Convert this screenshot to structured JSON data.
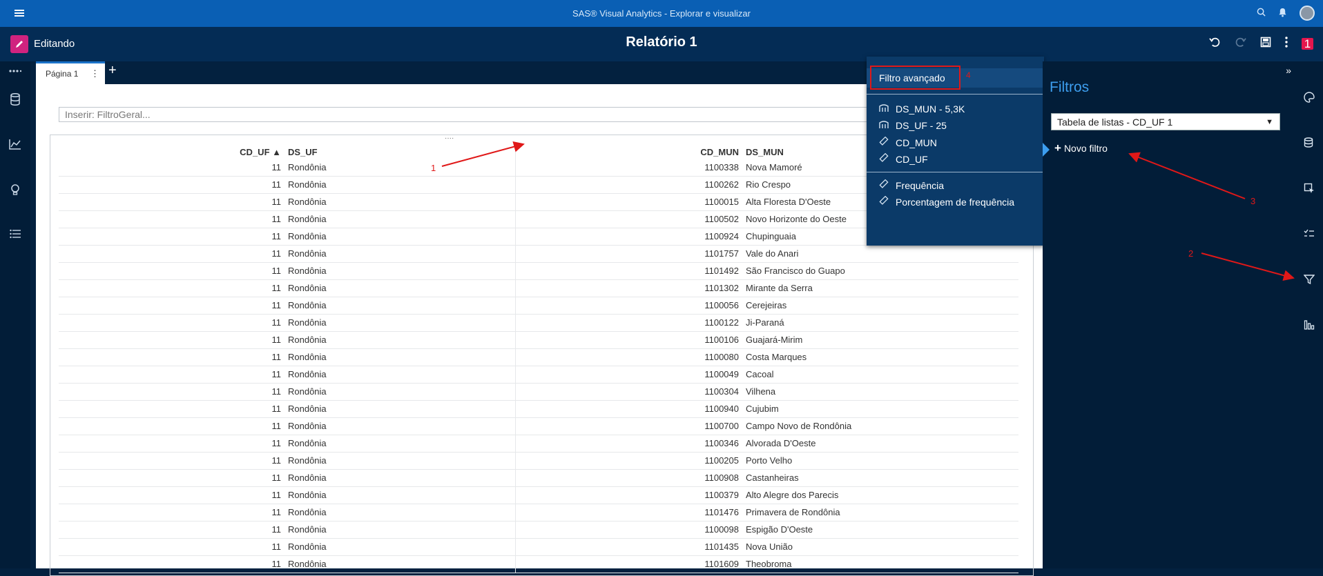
{
  "app": {
    "title": "SAS® Visual Analytics - Explorar e visualizar"
  },
  "topbar_icons": [
    "menu-icon",
    "search-icon",
    "bell-icon",
    "user-avatar"
  ],
  "editbar": {
    "mode_label": "Editando",
    "report_title": "Relatório 1",
    "notification_count": "1"
  },
  "tabs": [
    {
      "label": "Página 1"
    }
  ],
  "filter_input": {
    "placeholder": "Inserir: FiltroGeral..."
  },
  "table": {
    "columns": [
      "CD_UF ▲",
      "DS_UF",
      "CD_MUN",
      "DS_MUN"
    ],
    "rows": [
      [
        "11",
        "Rondônia",
        "1100338",
        "Nova Mamoré"
      ],
      [
        "11",
        "Rondônia",
        "1100262",
        "Rio Crespo"
      ],
      [
        "11",
        "Rondônia",
        "1100015",
        "Alta Floresta D'Oeste"
      ],
      [
        "11",
        "Rondônia",
        "1100502",
        "Novo Horizonte do Oeste"
      ],
      [
        "11",
        "Rondônia",
        "1100924",
        "Chupinguaia"
      ],
      [
        "11",
        "Rondônia",
        "1101757",
        "Vale do Anari"
      ],
      [
        "11",
        "Rondônia",
        "1101492",
        "São Francisco do Guapo"
      ],
      [
        "11",
        "Rondônia",
        "1101302",
        "Mirante da Serra"
      ],
      [
        "11",
        "Rondônia",
        "1100056",
        "Cerejeiras"
      ],
      [
        "11",
        "Rondônia",
        "1100122",
        "Ji-Paraná"
      ],
      [
        "11",
        "Rondônia",
        "1100106",
        "Guajará-Mirim"
      ],
      [
        "11",
        "Rondônia",
        "1100080",
        "Costa Marques"
      ],
      [
        "11",
        "Rondônia",
        "1100049",
        "Cacoal"
      ],
      [
        "11",
        "Rondônia",
        "1100304",
        "Vilhena"
      ],
      [
        "11",
        "Rondônia",
        "1100940",
        "Cujubim"
      ],
      [
        "11",
        "Rondônia",
        "1100700",
        "Campo Novo de Rondônia"
      ],
      [
        "11",
        "Rondônia",
        "1100346",
        "Alvorada D'Oeste"
      ],
      [
        "11",
        "Rondônia",
        "1100205",
        "Porto Velho"
      ],
      [
        "11",
        "Rondônia",
        "1100908",
        "Castanheiras"
      ],
      [
        "11",
        "Rondônia",
        "1100379",
        "Alto Alegre dos Parecis"
      ],
      [
        "11",
        "Rondônia",
        "1101476",
        "Primavera de Rondônia"
      ],
      [
        "11",
        "Rondônia",
        "1100098",
        "Espigão D'Oeste"
      ],
      [
        "11",
        "Rondônia",
        "1101435",
        "Nova União"
      ],
      [
        "11",
        "Rondônia",
        "1101609",
        "Theobroma"
      ]
    ]
  },
  "context_menu": {
    "advanced": "Filtro avançado",
    "data_items": [
      {
        "label": "DS_MUN - 5,3K",
        "icon": "category-icon"
      },
      {
        "label": "DS_UF - 25",
        "icon": "category-icon"
      },
      {
        "label": "CD_MUN",
        "icon": "measure-icon"
      },
      {
        "label": "CD_UF",
        "icon": "measure-icon"
      }
    ],
    "aggregates": [
      {
        "label": "Frequência",
        "icon": "measure-icon"
      },
      {
        "label": "Porcentagem de frequência",
        "icon": "measure-icon"
      }
    ]
  },
  "filters_panel": {
    "title": "Filtros",
    "selected_object": "Tabela de listas - CD_UF 1",
    "new_filter": "Novo filtro"
  },
  "annotations": [
    "1",
    "2",
    "3",
    "4"
  ],
  "colors": {
    "topbar": "#0a5fb4",
    "panel": "#021d38",
    "accent": "#3d9eef",
    "annotation": "#e01818",
    "edit_badge": "#d0237f"
  }
}
